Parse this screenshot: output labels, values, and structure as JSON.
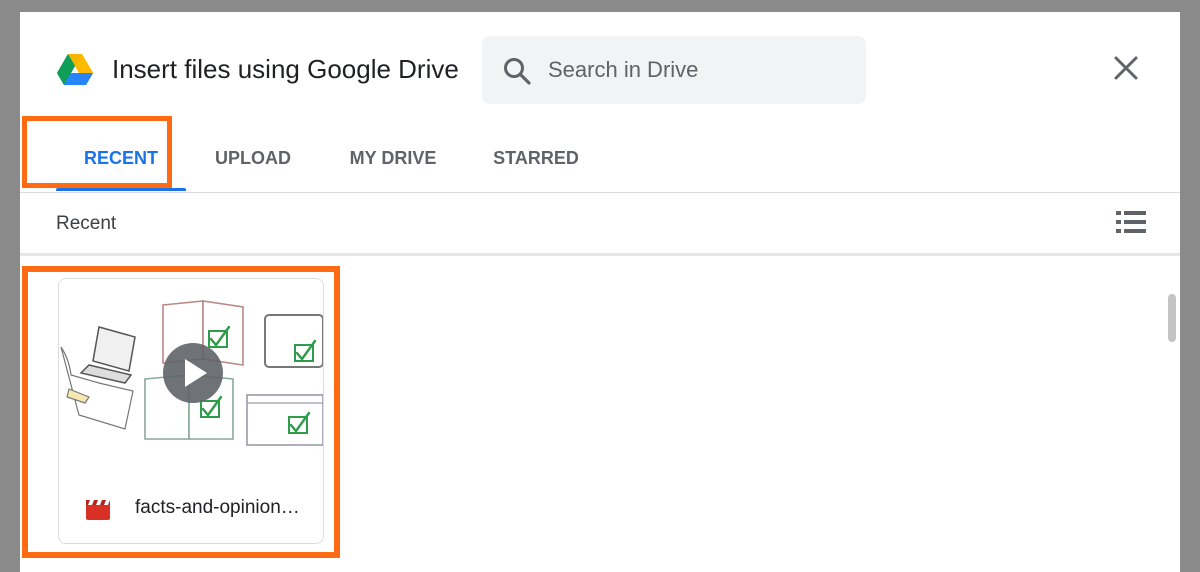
{
  "dialog": {
    "title": "Insert files using Google Drive",
    "logo_icon": "google-drive-icon",
    "close_icon": "close-icon"
  },
  "search": {
    "icon": "search-icon",
    "placeholder": "Search in Drive",
    "value": ""
  },
  "tabs": [
    {
      "label": "RECENT",
      "active": true
    },
    {
      "label": "UPLOAD",
      "active": false
    },
    {
      "label": "MY DRIVE",
      "active": false
    },
    {
      "label": "STARRED",
      "active": false
    }
  ],
  "section": {
    "label": "Recent",
    "view_toggle_icon": "list-view-icon"
  },
  "files": [
    {
      "name": "facts-and-opinion…",
      "type_icon": "video-file-icon",
      "thumbnail_icon": "play-icon"
    }
  ],
  "colors": {
    "accent": "#1a73e8",
    "highlight": "#ff6a13",
    "video_icon": "#d93025"
  }
}
